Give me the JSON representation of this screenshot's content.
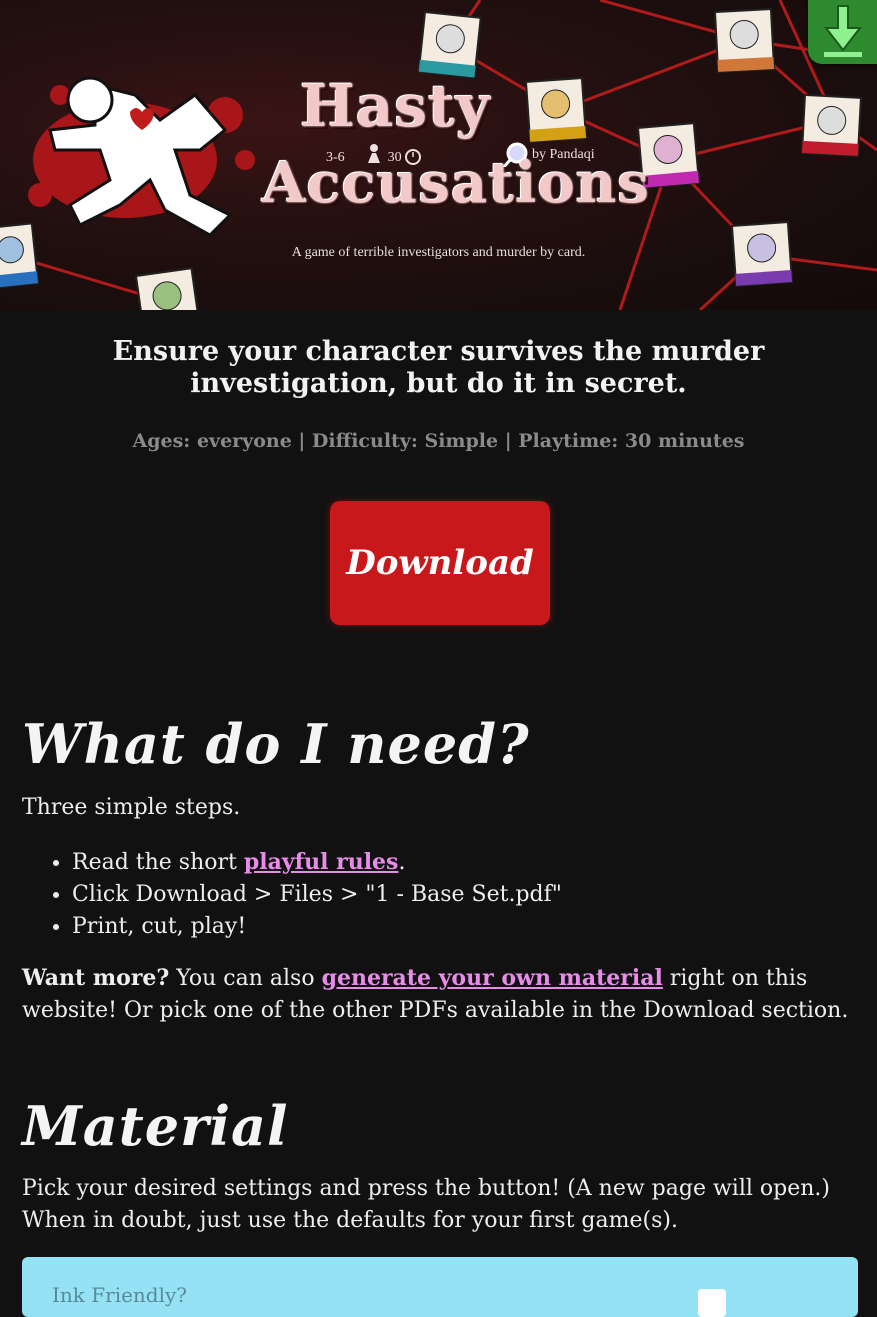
{
  "header": {
    "logo_line1": "Hasty",
    "logo_line2": "Accusations",
    "players": "3-6",
    "minutes": "30",
    "author": "by Pandaqi",
    "tagline": "A game of terrible investigators and murder by card."
  },
  "intro": {
    "heading": "Ensure your character survives the murder investigation, but do it in secret.",
    "meta": "Ages: everyone | Difficulty: Simple | Playtime: 30 minutes"
  },
  "download_button": {
    "label": "Download"
  },
  "need_section": {
    "title": "What do I need?",
    "subtitle": "Three simple steps.",
    "step1_prefix": "Read the short ",
    "step1_link": "playful rules",
    "step1_suffix": ".",
    "step2": "Click Download > Files > \"1 - Base Set.pdf\"",
    "step3": "Print, cut, play!",
    "more_bold": "Want more?",
    "more_text1": " You can also ",
    "more_link": "generate your own material",
    "more_text2": " right on this website! Or pick one of the other PDFs available in the Download section."
  },
  "material_section": {
    "title": "Material",
    "text": "Pick your desired settings and press the button! (A new page will open.) When in doubt, just use the defaults for your first game(s).",
    "first_setting_label": "Ink Friendly?"
  },
  "colors": {
    "background": "#111111",
    "download_red": "#c8181b",
    "link_pink": "#e98ce9",
    "panel_blue": "#94e2f4",
    "corner_green": "#2e8a2e"
  },
  "icons": [
    "download-arrow-icon",
    "magnifier-icon",
    "pawn-icon",
    "clock-icon"
  ]
}
